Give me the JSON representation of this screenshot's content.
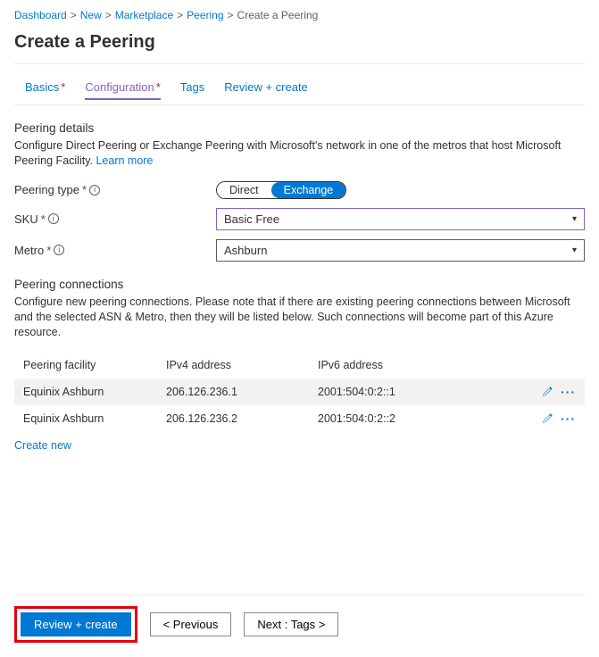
{
  "breadcrumbs": {
    "items": [
      "Dashboard",
      "New",
      "Marketplace",
      "Peering"
    ],
    "current": "Create a Peering"
  },
  "page_title": "Create a Peering",
  "tabs": {
    "basics": "Basics",
    "configuration": "Configuration",
    "tags": "Tags",
    "review": "Review + create"
  },
  "details": {
    "heading": "Peering details",
    "help": "Configure Direct Peering or Exchange Peering with Microsoft's network in one of the metros that host Microsoft Peering Facility. ",
    "learn_more": "Learn more"
  },
  "fields": {
    "peering_type_label": "Peering type",
    "peering_type_options": {
      "direct": "Direct",
      "exchange": "Exchange"
    },
    "sku_label": "SKU",
    "sku_value": "Basic Free",
    "metro_label": "Metro",
    "metro_value": "Ashburn"
  },
  "connections": {
    "heading": "Peering connections",
    "help": "Configure new peering connections. Please note that if there are existing peering connections between Microsoft and the selected ASN & Metro, then they will be listed below. Such connections will become part of this Azure resource.",
    "columns": {
      "facility": "Peering facility",
      "ipv4": "IPv4 address",
      "ipv6": "IPv6 address"
    },
    "rows": [
      {
        "facility": "Equinix Ashburn",
        "ipv4": "206.126.236.1",
        "ipv6": "2001:504:0:2::1"
      },
      {
        "facility": "Equinix Ashburn",
        "ipv4": "206.126.236.2",
        "ipv6": "2001:504:0:2::2"
      }
    ],
    "create_new": "Create new"
  },
  "footer": {
    "review": "Review + create",
    "previous": "< Previous",
    "next": "Next : Tags >"
  }
}
